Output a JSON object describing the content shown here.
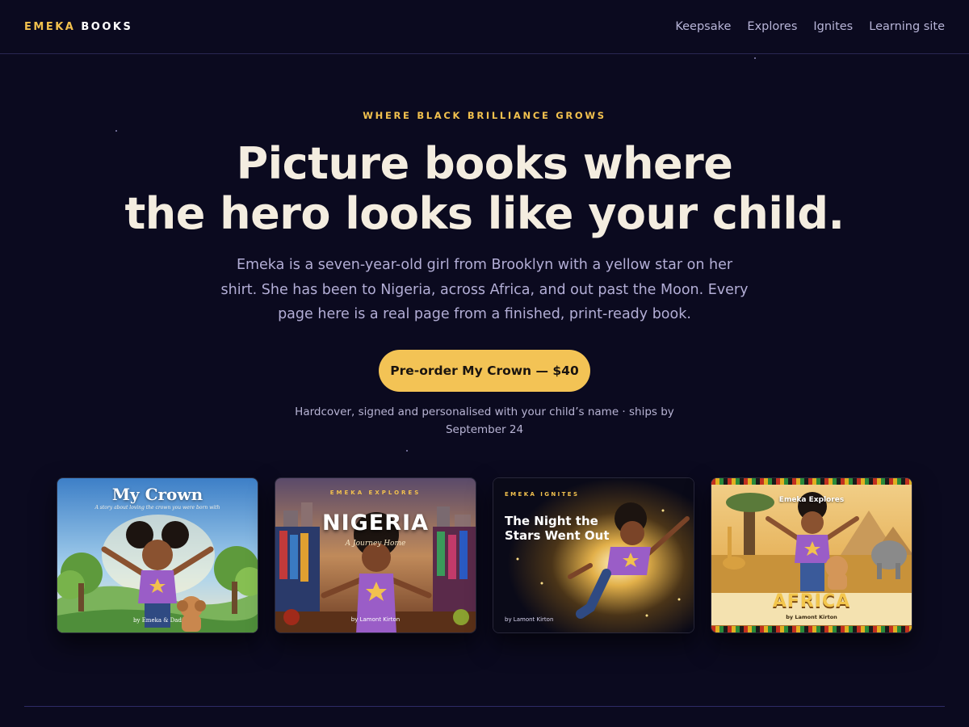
{
  "header": {
    "logo_accent": "EMEKA",
    "logo_rest": "BOOKS",
    "nav": [
      "Keepsake",
      "Explores",
      "Ignites",
      "Learning site"
    ]
  },
  "hero": {
    "eyebrow": "WHERE BLACK BRILLIANCE GROWS",
    "headline_line1": "Picture books where",
    "headline_line2": "the hero looks like your child.",
    "lede": "Emeka is a seven-year-old girl from Brooklyn with a yellow star on her shirt. She has been to Nigeria, across Africa, and out past the Moon. Every page here is a real page from a finished, print-ready book.",
    "cta_label": "Pre-order My Crown — $40",
    "cta_note": "Hardcover, signed and personalised with your child’s name · ships by September 24"
  },
  "books": [
    {
      "title": "My Crown",
      "subtitle": "A story about loving the crown you were born with",
      "byline": "by Emeka & Dad"
    },
    {
      "series": "EMEKA EXPLORES",
      "title": "NIGERIA",
      "subtitle": "A Journey Home",
      "byline": "by Lamont Kirton"
    },
    {
      "series": "EMEKA IGNITES",
      "title": "The Night the Stars Went Out",
      "byline": "by Lamont Kirton"
    },
    {
      "series": "Emeka Explores",
      "title": "AFRICA",
      "byline": "by Lamont Kirton"
    }
  ],
  "colors": {
    "background": "#0b0a1f",
    "accent": "#f2c14e",
    "button": "#f3c355",
    "headline": "#f4ede0",
    "body_text": "#b3aed6"
  }
}
